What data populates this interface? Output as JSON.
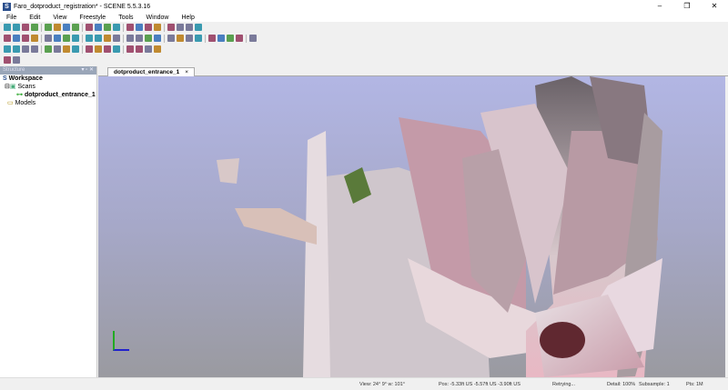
{
  "window": {
    "title": "Faro_dotproduct_registration* - SCENE 5.5.3.16",
    "app_icon": "S"
  },
  "menu": [
    "File",
    "Edit",
    "View",
    "Freestyle",
    "Tools",
    "Window",
    "Help"
  ],
  "toolbars": {
    "row1": [
      "new-project-icon",
      "open-icon",
      "save-icon",
      "print-icon",
      "help-icon",
      "scan-icon",
      "3d-view-icon",
      "2d-view-icon",
      "home-icon",
      "undo-icon",
      "redo-icon",
      "export-icon",
      "import-icon",
      "layout-icon",
      "view-icon",
      "filter-icon",
      "settings-icon",
      "globe-icon",
      "cube-icon",
      "cube-icon"
    ],
    "row2": [
      "select-icon",
      "sphere-icon",
      "link-icon",
      "unlink-icon",
      "target-icon",
      "register-icon",
      "register-icon",
      "cube-front-icon",
      "cube-side-icon",
      "cube-top-icon",
      "orbit-icon",
      "orbit-icon",
      "zoom-icon",
      "pan-icon",
      "camera-icon",
      "mesh-icon",
      "render-icon",
      "mode-icon",
      "grid-icon",
      "grid-icon",
      "grid-icon",
      "grid-icon",
      "grid-icon",
      "measure-icon",
      "cube-icon"
    ],
    "row3": [
      "point-icon",
      "line-icon",
      "polyline-icon",
      "polygon-icon",
      "area-icon",
      "angle-icon",
      "rectangle-icon",
      "line-icon",
      "flag-icon",
      "circle-icon",
      "cylinder-icon",
      "corner-icon",
      "window-icon",
      "window-tile-icon",
      "window-cascade-icon",
      "window-split-icon"
    ],
    "row4": [
      "layers-icon",
      "structure-icon"
    ]
  },
  "structure_panel": {
    "title": "Structure",
    "controls": "▾ ▫ ✕",
    "workspace": "Workspace",
    "scans": "Scans",
    "scan_item": "dotproduct_entrance_1",
    "models": "Models"
  },
  "tabs": [
    {
      "label": "dotproduct_entrance_1",
      "close": "×"
    }
  ],
  "status": {
    "view": "View: 24° 9° w: 101°",
    "pos": "Pos: -5.33ft US -5.57ft US -3.90ft US",
    "state": "Retrying...",
    "detail": "Detail: 100%",
    "subsample": "Subsample: 1",
    "pts": "Pts: 1M"
  },
  "window_controls": [
    "–",
    "❐",
    "✕"
  ]
}
